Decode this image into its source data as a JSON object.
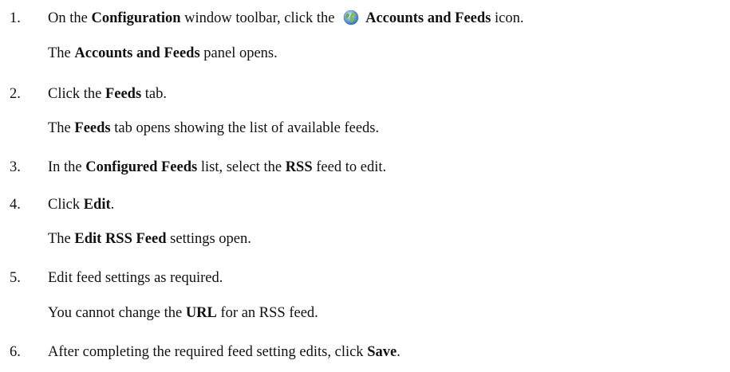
{
  "steps": [
    {
      "number": "1.",
      "parts": [
        "On the ",
        "Configuration",
        " window toolbar, click the ",
        "Accounts and Feeds",
        " icon."
      ],
      "icon": "globe-icon",
      "result": [
        "The ",
        "Accounts and Feeds",
        " panel opens."
      ]
    },
    {
      "number": "2.",
      "parts": [
        "Click the ",
        "Feeds",
        " tab."
      ],
      "result": [
        "The ",
        "Feeds",
        " tab opens showing the list of available feeds."
      ]
    },
    {
      "number": "3.",
      "parts": [
        "In the ",
        "Configured Feeds",
        " list, select the ",
        "RSS",
        " feed to edit."
      ]
    },
    {
      "number": "4.",
      "parts": [
        "Click ",
        "Edit",
        "."
      ],
      "result": [
        "The ",
        "Edit RSS Feed",
        " settings open."
      ]
    },
    {
      "number": "5.",
      "parts": [
        "Edit feed settings as required."
      ],
      "result": [
        "You cannot change the ",
        "URL",
        " for an RSS feed."
      ]
    },
    {
      "number": "6.",
      "parts": [
        "After completing the required feed setting edits, click ",
        "Save",
        "."
      ]
    }
  ]
}
